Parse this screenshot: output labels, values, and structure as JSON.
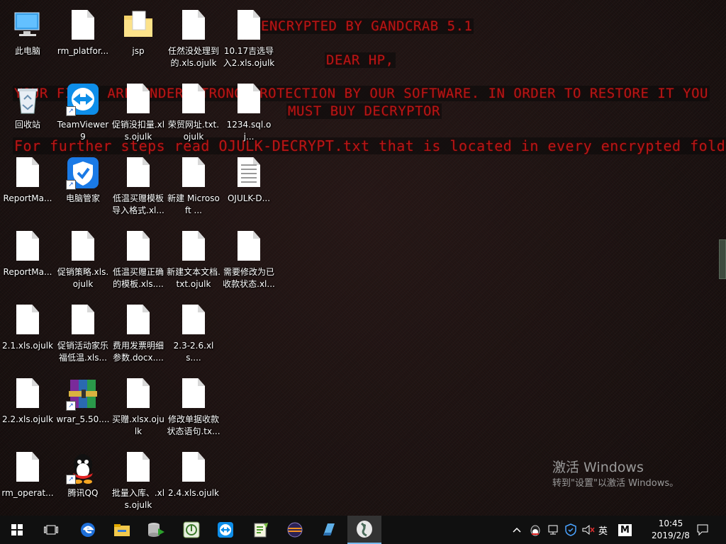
{
  "ransom": {
    "title": "ENCRYPTED BY GANDCRAB 5.1",
    "dear": "DEAR HP,",
    "line1": "YOUR FILES ARE UNDER STRONG PROTECTION BY OUR SOFTWARE. IN ORDER TO RESTORE IT YOU",
    "line2": "MUST BUY DECRYPTOR",
    "line3": "For further steps read OJULK-DECRYPT.txt that is located in every encrypted folder"
  },
  "desktop_icons": [
    {
      "label": "此电脑",
      "icon": "computer-icon"
    },
    {
      "label": "rm_platfor...",
      "icon": "file-icon"
    },
    {
      "label": "jsp",
      "icon": "folder-icon"
    },
    {
      "label": "任然没处理到的.xls.ojulk",
      "icon": "file-icon"
    },
    {
      "label": "10.17吉选导入2.xls.ojulk",
      "icon": "file-icon"
    },
    {
      "label": "回收站",
      "icon": "recycle-bin-icon"
    },
    {
      "label": "TeamViewer 9",
      "icon": "teamviewer-icon"
    },
    {
      "label": "促销没扣量.xls.ojulk",
      "icon": "file-icon"
    },
    {
      "label": "荣贸网址.txt.ojulk",
      "icon": "file-icon"
    },
    {
      "label": "1234.sql.oj...",
      "icon": "file-icon"
    },
    {
      "label": "ReportMa...",
      "icon": "file-icon"
    },
    {
      "label": "电脑管家",
      "icon": "pc-manager-icon"
    },
    {
      "label": "低温买赠模板导入格式.xl...",
      "icon": "file-icon"
    },
    {
      "label": "新建 Microsoft ...",
      "icon": "file-icon"
    },
    {
      "label": "OJULK-D...",
      "icon": "text-file-icon"
    },
    {
      "label": "ReportMa...",
      "icon": "file-icon"
    },
    {
      "label": "促销策略.xls.ojulk",
      "icon": "file-icon"
    },
    {
      "label": "低温买赠正确的模板.xls....",
      "icon": "file-icon"
    },
    {
      "label": "新建文本文档.txt.ojulk",
      "icon": "file-icon"
    },
    {
      "label": "需要修改为已收款状态.xl...",
      "icon": "file-icon"
    },
    {
      "label": "2.1.xls.ojulk",
      "icon": "file-icon"
    },
    {
      "label": "促销活动家乐福低温.xls...",
      "icon": "file-icon"
    },
    {
      "label": "费用发票明细参数.docx....",
      "icon": "file-icon"
    },
    {
      "label": "2.3-2.6.xls....",
      "icon": "file-icon"
    },
    {
      "label": "2.2.xls.ojulk",
      "icon": "file-icon"
    },
    {
      "label": "wrar_5.50....",
      "icon": "winrar-icon"
    },
    {
      "label": "买赠.xlsx.ojulk",
      "icon": "file-icon"
    },
    {
      "label": "修改单据收款状态语句.tx...",
      "icon": "file-icon"
    },
    {
      "label": "rm_operat...",
      "icon": "file-icon"
    },
    {
      "label": "腾讯QQ",
      "icon": "qq-icon"
    },
    {
      "label": "批量入库、.xls.ojulk",
      "icon": "file-icon"
    },
    {
      "label": "2.4.xls.ojulk",
      "icon": "file-icon"
    }
  ],
  "watermark": {
    "title": "激活 Windows",
    "subtitle": "转到\"设置\"以激活 Windows。"
  },
  "taskbar": {
    "apps": [
      "start-icon",
      "task-view-icon",
      "edge-icon",
      "file-explorer-icon",
      "database-tool-icon",
      "green-app-icon",
      "teamviewer-icon",
      "notepad-plus-icon",
      "eclipse-icon",
      "blue-app-icon",
      "picture-viewer-icon"
    ],
    "tray": {
      "ime": "英",
      "ime_mode": "M",
      "time": "10:45",
      "date": "2019/2/8"
    }
  },
  "colors": {
    "ransom_text": "#b81616",
    "taskbar": "#101010",
    "accent": "#76b9ed"
  }
}
